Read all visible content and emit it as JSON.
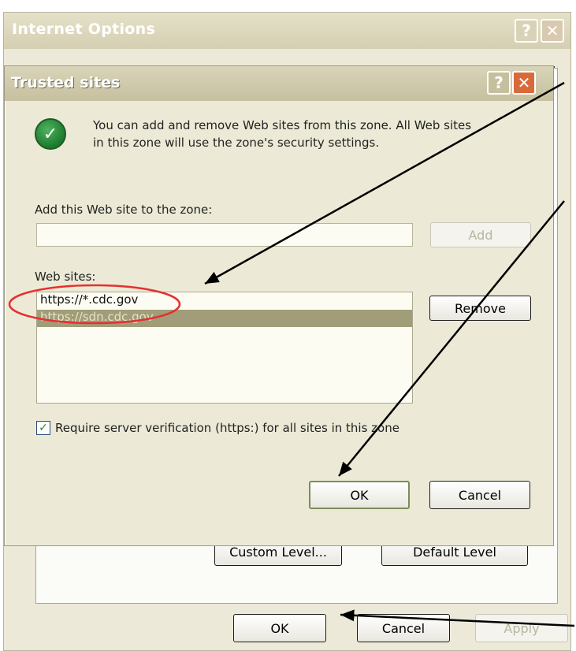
{
  "outer_window": {
    "title": "Internet Options",
    "custom_level_label": "Custom Level...",
    "default_level_label": "Default Level",
    "ok_label": "OK",
    "cancel_label": "Cancel",
    "apply_label": "Apply"
  },
  "dialog": {
    "title": "Trusted sites",
    "info_line_1": "You can add and remove Web sites from this zone. All Web sites",
    "info_line_2": "in this zone will use the zone's security settings.",
    "add_label": "Add this Web site to the zone:",
    "site_input_value": "",
    "add_button": "Add",
    "websites_label": "Web sites:",
    "websites": [
      {
        "url": "https://*.cdc.gov",
        "selected": false
      },
      {
        "url": "https://sdn.cdc.gov",
        "selected": true
      }
    ],
    "remove_button": "Remove",
    "require_verification_label": "Require server verification (https:) for all sites in this zone",
    "require_verification_checked": true,
    "ok_label": "OK",
    "cancel_label": "Cancel"
  },
  "icons": {
    "help": "help-icon",
    "close": "close-icon",
    "check": "checkmark-icon"
  },
  "colors": {
    "highlight_circle": "#e53030",
    "arrow": "#000000",
    "selected_row": "#a19d79"
  }
}
